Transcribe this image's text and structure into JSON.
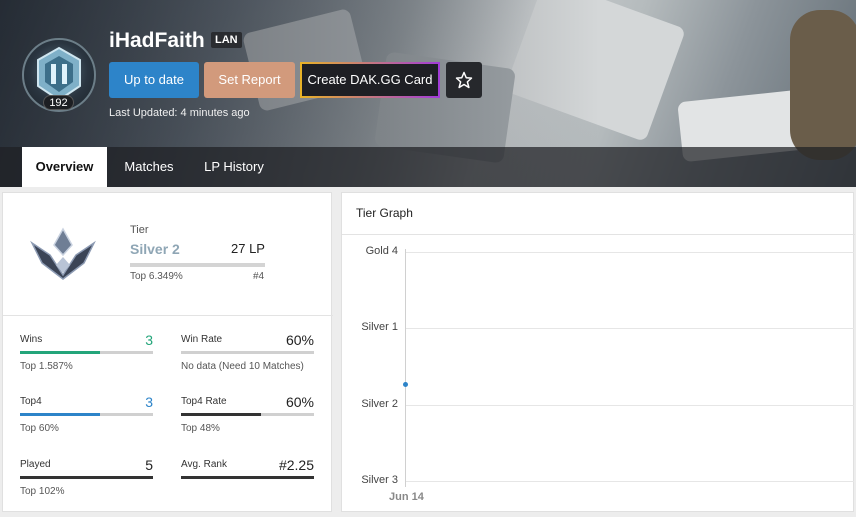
{
  "profile": {
    "username": "iHadFaith",
    "region": "LAN",
    "level": "192",
    "last_updated": "Last Updated: 4 minutes ago"
  },
  "actions": {
    "update_label": "Up to date",
    "report_label": "Set Report",
    "card_label": "Create DAK.GG Card",
    "star_icon": "star-icon"
  },
  "tabs": [
    {
      "label": "Overview",
      "active": true
    },
    {
      "label": "Matches",
      "active": false
    },
    {
      "label": "LP History",
      "active": false
    }
  ],
  "tier": {
    "label": "Tier",
    "name": "Silver 2",
    "lp": "27 LP",
    "top": "Top 6.349%",
    "rank": "#4"
  },
  "stats": [
    {
      "label": "Wins",
      "value": "3",
      "sub": "Top 1.587%",
      "value_color": "#23a57a",
      "fill": 0.6,
      "fill_color": "#23a57a"
    },
    {
      "label": "Win Rate",
      "value": "60%",
      "sub": "No data (Need 10 Matches)",
      "value_color": "#222222",
      "fill": 0.0,
      "fill_color": "#333333"
    },
    {
      "label": "Top4",
      "value": "3",
      "sub": "Top 60%",
      "value_color": "#2d84c9",
      "fill": 0.6,
      "fill_color": "#2d84c9"
    },
    {
      "label": "Top4 Rate",
      "value": "60%",
      "sub": "Top 48%",
      "value_color": "#222222",
      "fill": 0.6,
      "fill_color": "#333333"
    },
    {
      "label": "Played",
      "value": "5",
      "sub": "Top 102%",
      "value_color": "#222222",
      "fill": 1.0,
      "fill_color": "#333333"
    },
    {
      "label": "Avg. Rank",
      "value": "#2.25",
      "sub": "",
      "value_color": "#222222",
      "fill": 1.0,
      "fill_color": "#333333"
    }
  ],
  "graph": {
    "title": "Tier Graph",
    "chart_data": {
      "type": "line",
      "y_categories": [
        "Gold 4",
        "Silver 1",
        "Silver 2",
        "Silver 3"
      ],
      "x": [
        "Jun 14"
      ],
      "series": [
        {
          "values": [
            "Silver 2 27 LP"
          ]
        }
      ]
    }
  },
  "colors": {
    "accent_blue": "#2d84c9",
    "report": "#d29a7c",
    "win_green": "#23a57a",
    "silver_text": "#8fa6b5"
  }
}
